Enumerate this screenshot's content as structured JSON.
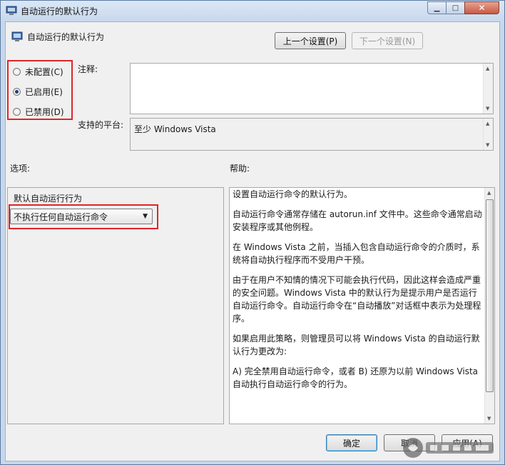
{
  "window": {
    "title": "自动运行的默认行为"
  },
  "header": {
    "title": "自动运行的默认行为"
  },
  "nav": {
    "prev_label": "上一个设置(P)",
    "next_label": "下一个设置(N)"
  },
  "state": {
    "options": [
      {
        "label": "未配置(C)",
        "checked": false
      },
      {
        "label": "已启用(E)",
        "checked": true
      },
      {
        "label": "已禁用(D)",
        "checked": false
      }
    ]
  },
  "comment": {
    "label": "注释:",
    "value": ""
  },
  "platform": {
    "label": "支持的平台:",
    "value": "至少 Windows Vista"
  },
  "options_panel": {
    "label": "选项:",
    "setting_label": "默认自动运行行为",
    "dropdown_value": "不执行任何自动运行命令"
  },
  "help_panel": {
    "label": "帮助:",
    "paragraphs": [
      "设置自动运行命令的默认行为。",
      "自动运行命令通常存储在 autorun.inf 文件中。这些命令通常启动安装程序或其他例程。",
      "在 Windows Vista 之前，当插入包含自动运行命令的介质时，系统将自动执行程序而不受用户干预。",
      "由于在用户不知情的情况下可能会执行代码，因此这样会造成严重的安全问题。Windows Vista 中的默认行为是提示用户是否运行自动运行命令。自动运行命令在“自动播放”对话框中表示为处理程序。",
      "如果启用此策略，则管理员可以将 Windows Vista 的自动运行默认行为更改为:",
      "A) 完全禁用自动运行命令，或者 B) 还原为以前 Windows Vista 自动执行自动运行命令的行为。"
    ]
  },
  "footer": {
    "ok_label": "确定",
    "cancel_label": "取消",
    "apply_label": "应用(A)"
  },
  "colors": {
    "highlight": "#e0252a",
    "radio_dot": "#1b3f74"
  },
  "icons": {
    "title": "policy-settings-icon",
    "header": "policy-settings-icon"
  }
}
